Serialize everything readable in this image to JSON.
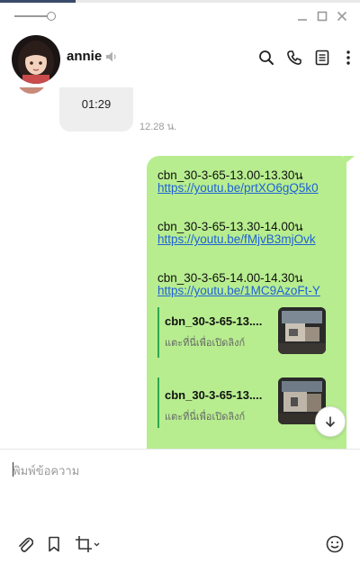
{
  "contact": {
    "name": "annie"
  },
  "audio_message": {
    "duration": "01:29",
    "time": "12.28 น."
  },
  "messages": [
    {
      "title": "cbn_30-3-65-13.00-13.30น",
      "link": "https://youtu.be/prtXO6gQ5k0"
    },
    {
      "title": "cbn_30-3-65-13.30-14.00น",
      "link": "https://youtu.be/fMjvB3mjOvk"
    },
    {
      "title": "cbn_30-3-65-14.00-14.30น",
      "link": "https://youtu.be/1MC9AzoFt-Y"
    }
  ],
  "previews": [
    {
      "title": "cbn_30-3-65-13....",
      "subtitle": "แตะที่นี่เพื่อเปิดลิงก์"
    },
    {
      "title": "cbn_30-3-65-13....",
      "subtitle": "แตะที่นี่เพื่อเปิดลิงก์"
    }
  ],
  "input": {
    "placeholder": "พิมพ์ข้อความ"
  },
  "colors": {
    "bubble_green": "#b7ed8f",
    "link_blue": "#1f62d6",
    "preview_bar": "#2fa84f"
  },
  "icons": {
    "window": [
      "opacity-slider",
      "minimize-icon",
      "maximize-icon",
      "close-icon"
    ],
    "header": [
      "mute-icon",
      "search-icon",
      "call-icon",
      "notes-icon",
      "more-icon"
    ],
    "toolbar": [
      "attach-icon",
      "bookmark-icon",
      "screenshot-icon",
      "emoji-icon"
    ]
  }
}
